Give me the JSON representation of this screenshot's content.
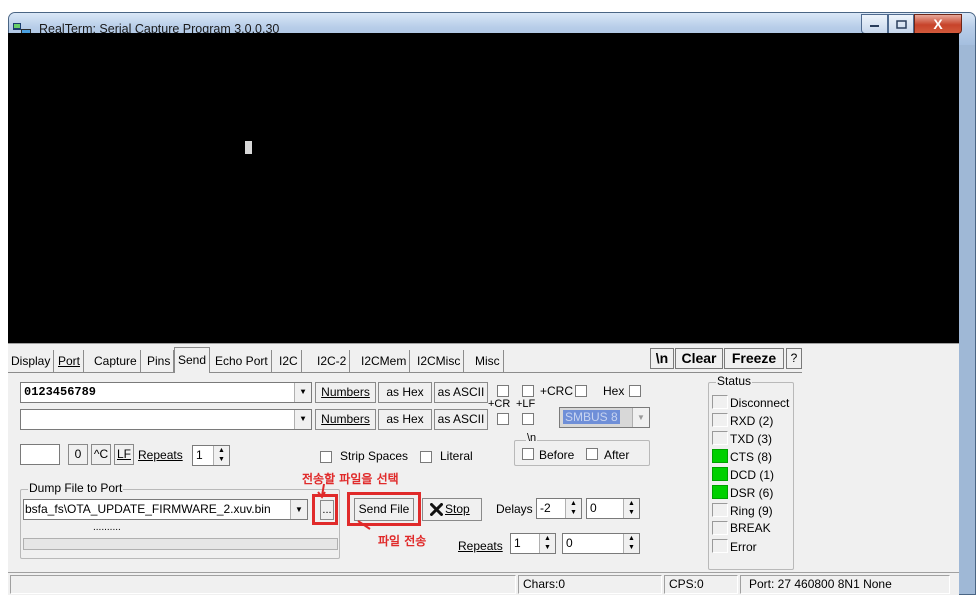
{
  "window": {
    "title": "RealTerm: Serial Capture Program 3.0.0.30",
    "close_glyph": "X"
  },
  "tabs": [
    "Display",
    "Port",
    "Capture",
    "Pins",
    "Send",
    "Echo Port",
    "I2C",
    "I2C-2",
    "I2CMem",
    "I2CMisc",
    "Misc"
  ],
  "toolbar": {
    "newline": "\\n",
    "clear": "Clear",
    "freeze": "Freeze",
    "help": "?"
  },
  "send": {
    "line1_value": "0123456789",
    "line2_value": "",
    "numbers_label": "Numbers",
    "as_hex_label": "as Hex",
    "as_ascii_label": "as ASCII",
    "plus_cr": "+CR",
    "plus_lf": "+LF",
    "plus_crc": "+CRC",
    "hex": "Hex",
    "smbus_value": "SMBUS 8",
    "char_value": "",
    "zero_btn": "0",
    "ctrl_c_btn": "^C",
    "lf_btn": "LF",
    "repeats_label": "Repeats",
    "repeats_value": "1",
    "strip_spaces": "Strip Spaces",
    "literal": "Literal",
    "nl_group": "\\n",
    "before": "Before",
    "after": "After"
  },
  "dump": {
    "group_label": "Dump File to Port",
    "file_value": "bsfa_fs\\OTA_UPDATE_FIRMWARE_2.xuv.bin",
    "browse_label": "...",
    "progress_text": "..........",
    "send_file_label": "Send File",
    "stop_label": "Stop",
    "delays_label": "Delays",
    "delay1": "-2",
    "delay2": "0",
    "repeats_label": "Repeats",
    "repeats1": "1",
    "repeats2": "0"
  },
  "annotations": {
    "select_file": "전송할 파일을 선택",
    "send_file": "파일 전송"
  },
  "status": {
    "group_label": "Status",
    "items": [
      {
        "label": "Disconnect",
        "on": false
      },
      {
        "label": "RXD (2)",
        "on": false
      },
      {
        "label": "TXD (3)",
        "on": false
      },
      {
        "label": "CTS (8)",
        "on": true
      },
      {
        "label": "DCD (1)",
        "on": true
      },
      {
        "label": "DSR (6)",
        "on": true
      },
      {
        "label": "Ring (9)",
        "on": false
      },
      {
        "label": "BREAK",
        "on": false
      },
      {
        "label": "Error",
        "on": false
      }
    ]
  },
  "statusbar": {
    "chars": "Chars:0",
    "cps": "CPS:0",
    "port": "Port: 27  460800 8N1 None"
  },
  "colors": {
    "terminal_bg": "#000000",
    "led_on": "#00d000",
    "annotation": "#e02a2a",
    "smbus_highlight": "#6f8fd8"
  }
}
